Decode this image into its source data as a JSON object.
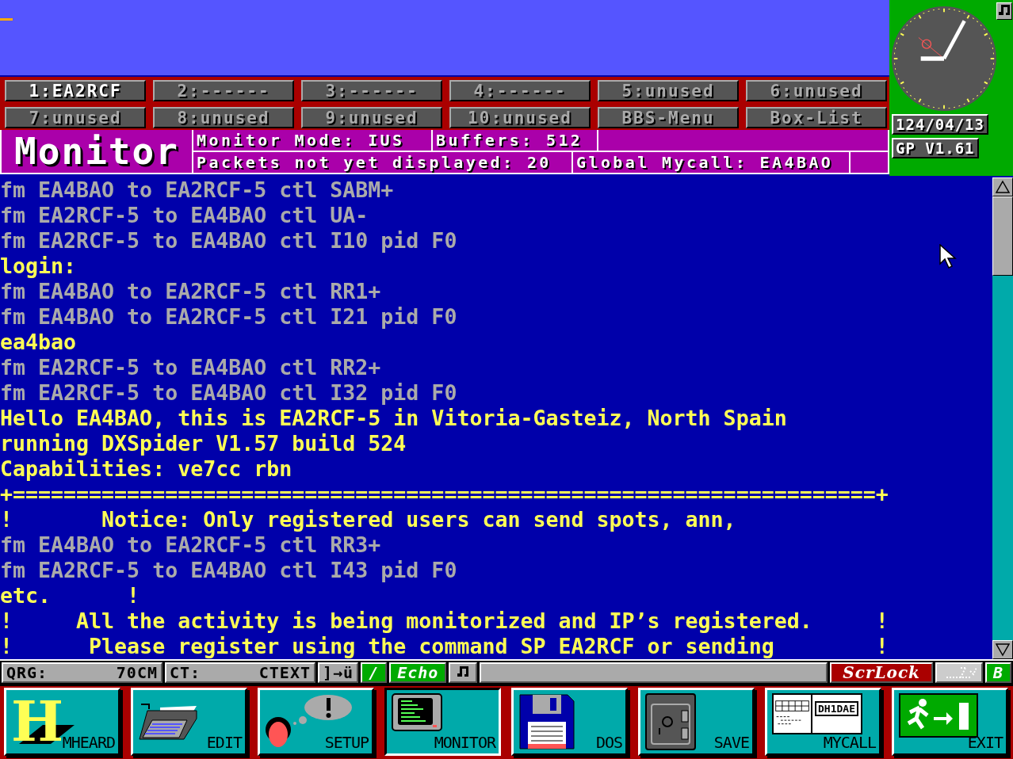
{
  "channel_buttons": [
    {
      "label": "1:EA2RCF",
      "selected": true
    },
    {
      "label": "2:------",
      "selected": false
    },
    {
      "label": "3:------",
      "selected": false
    },
    {
      "label": "4:------",
      "selected": false
    },
    {
      "label": "5:unused",
      "selected": false
    },
    {
      "label": "6:unused",
      "selected": false
    },
    {
      "label": "7:unused",
      "selected": false
    },
    {
      "label": "8:unused",
      "selected": false
    },
    {
      "label": "9:unused",
      "selected": false
    },
    {
      "label": "10:unused",
      "selected": false
    },
    {
      "label": "BBS-Menu",
      "selected": false
    },
    {
      "label": "Box-List",
      "selected": false
    }
  ],
  "header": {
    "title": "Monitor",
    "mode": "Monitor Mode: IUS",
    "buffers": "Buffers: 512",
    "pending": "Packets not yet displayed: 20",
    "mycall": "Global Mycall: EA4BAO"
  },
  "clock_panel": {
    "date": "124/04/13",
    "version": "GP V1.61"
  },
  "terminal": {
    "lines": [
      {
        "kind": "rx",
        "text": "fm EA4BAO to EA2RCF-5 ctl SABM+"
      },
      {
        "kind": "rx",
        "text": "fm EA2RCF-5 to EA4BAO ctl UA-"
      },
      {
        "kind": "rx",
        "text": "fm EA2RCF-5 to EA4BAO ctl I10 pid F0"
      },
      {
        "kind": "data",
        "text": "login:"
      },
      {
        "kind": "rx",
        "text": "fm EA4BAO to EA2RCF-5 ctl RR1+"
      },
      {
        "kind": "rx",
        "text": "fm EA4BAO to EA2RCF-5 ctl I21 pid F0"
      },
      {
        "kind": "data",
        "text": "ea4bao"
      },
      {
        "kind": "rx",
        "text": "fm EA2RCF-5 to EA4BAO ctl RR2+"
      },
      {
        "kind": "rx",
        "text": "fm EA2RCF-5 to EA4BAO ctl I32 pid F0"
      },
      {
        "kind": "data",
        "text": "Hello EA4BAO, this is EA2RCF-5 in Vitoria-Gasteiz, North Spain"
      },
      {
        "kind": "data",
        "text": "running DXSpider V1.57 build 524"
      },
      {
        "kind": "data",
        "text": "Capabilities: ve7cc rbn"
      },
      {
        "kind": "data",
        "text": "+====================================================================+"
      },
      {
        "kind": "data",
        "text": "!       Notice: Only registered users can send spots, ann,"
      },
      {
        "kind": "rx",
        "text": "fm EA4BAO to EA2RCF-5 ctl RR3+"
      },
      {
        "kind": "rx",
        "text": "fm EA2RCF-5 to EA4BAO ctl I43 pid F0"
      },
      {
        "kind": "data",
        "text": "etc.      !"
      },
      {
        "kind": "data",
        "text": "!     All the activity is being monitorized and IP’s registered.     !"
      },
      {
        "kind": "data",
        "text": "!      Please register using the command SP EA2RCF or sending        !"
      }
    ]
  },
  "status_bar": {
    "items": [
      {
        "kind": "field",
        "label": "QRG:",
        "value": "70CM"
      },
      {
        "kind": "field",
        "label": "CT:",
        "value": "CTEXT"
      },
      {
        "kind": "key",
        "text": "]→ü"
      },
      {
        "kind": "toggle",
        "text": "/",
        "on": true
      },
      {
        "kind": "toggle",
        "text": "Echo",
        "on": true
      },
      {
        "kind": "note"
      },
      {
        "kind": "spacer"
      },
      {
        "kind": "lock",
        "text": "ScrLock",
        "on": true
      },
      {
        "kind": "image"
      },
      {
        "kind": "toggle",
        "text": "B",
        "on": true
      }
    ]
  },
  "toolbar": [
    {
      "kind": "mheard",
      "label": "MHEARD",
      "mark": "H",
      "selected": false
    },
    {
      "kind": "edit",
      "label": "EDIT",
      "selected": false
    },
    {
      "kind": "setup",
      "label": "SETUP",
      "selected": false
    },
    {
      "kind": "monitor",
      "label": "MONITOR",
      "selected": true
    },
    {
      "kind": "dos",
      "label": "DOS",
      "selected": false
    },
    {
      "kind": "save",
      "label": "SAVE",
      "selected": false
    },
    {
      "kind": "mycall",
      "label": "MYCALL",
      "card_text": "DH1DAE",
      "selected": false
    },
    {
      "kind": "exit",
      "label": "EXIT",
      "selected": false
    }
  ]
}
